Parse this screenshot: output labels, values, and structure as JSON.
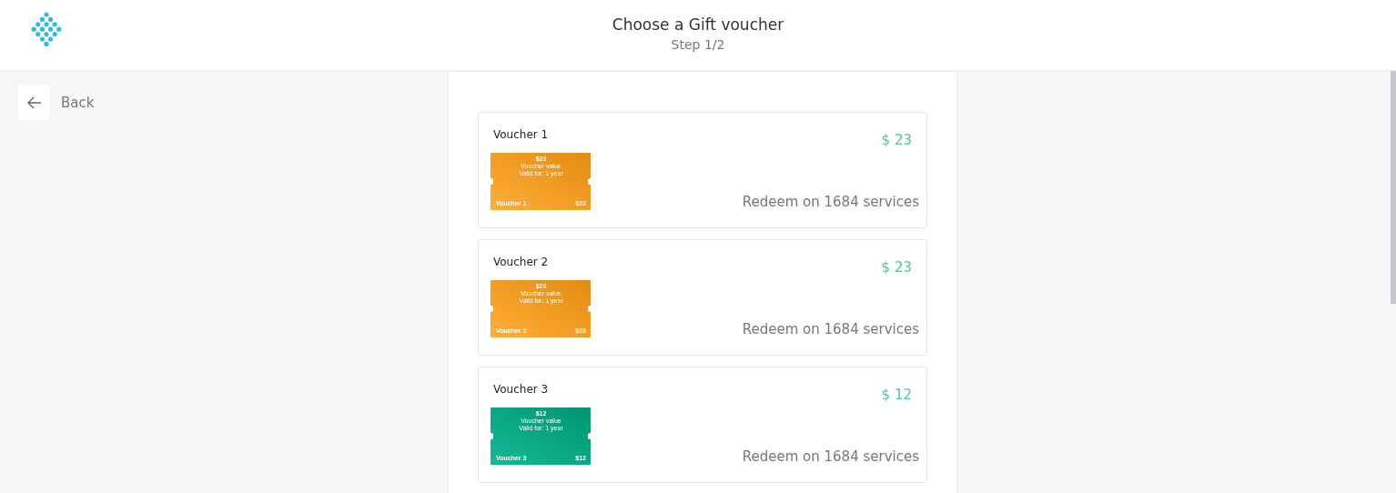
{
  "header": {
    "title": "Choose a Gift voucher",
    "step": "Step 1/2"
  },
  "back": {
    "label": "Back"
  },
  "vouchers": [
    {
      "name": "Voucher 1",
      "price": "$ 23",
      "redeem": "Redeem on 1684 services",
      "color": "#f39a22",
      "card": {
        "amount": "$23",
        "caption": "Voucher value",
        "validity": "Valid for: 1 year",
        "name": "Voucher 1",
        "value": "$23"
      }
    },
    {
      "name": "Voucher 2",
      "price": "$ 23",
      "redeem": "Redeem on 1684 services",
      "color": "#f39a22",
      "card": {
        "amount": "$23",
        "caption": "Voucher value",
        "validity": "Valid for: 1 year",
        "name": "Voucher 2",
        "value": "$23"
      }
    },
    {
      "name": "Voucher 3",
      "price": "$ 12",
      "redeem": "Redeem on 1684 services",
      "color": "#00a580",
      "card": {
        "amount": "$12",
        "caption": "Voucher value",
        "validity": "Valid for: 1 year",
        "name": "Voucher 3",
        "value": "$12"
      }
    }
  ]
}
